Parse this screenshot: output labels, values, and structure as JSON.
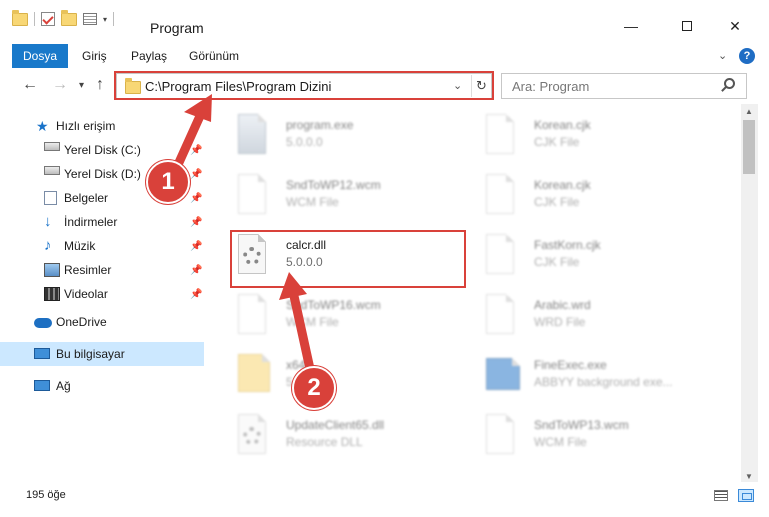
{
  "window": {
    "title": "Program",
    "minimize": "—",
    "close": "✕"
  },
  "ribbon": {
    "tabs": [
      "Dosya",
      "Giriş",
      "Paylaş",
      "Görünüm"
    ],
    "expand": "⌄",
    "help": "?"
  },
  "nav": {
    "back": "←",
    "forward": "→",
    "recent": "▾",
    "up": "↑",
    "address": "C:\\Program Files\\Program Dizini",
    "address_chevron": "⌄",
    "refresh": "↻",
    "search_placeholder": "Ara: Program"
  },
  "sidebar": {
    "quick_access": "Hızlı erişim",
    "items": [
      {
        "label": "Yerel Disk (C:)",
        "icon": "drive-icon"
      },
      {
        "label": "Yerel Disk (D:)",
        "icon": "drive-icon"
      },
      {
        "label": "Belgeler",
        "icon": "documents-icon"
      },
      {
        "label": "İndirmeler",
        "icon": "downloads-icon"
      },
      {
        "label": "Müzik",
        "icon": "music-icon"
      },
      {
        "label": "Resimler",
        "icon": "pictures-icon"
      },
      {
        "label": "Videolar",
        "icon": "videos-icon"
      }
    ],
    "pin": "📌",
    "onedrive": "OneDrive",
    "this_pc": "Bu bilgisayar",
    "network": "Ağ"
  },
  "files": {
    "left": [
      {
        "name": "program.exe",
        "sub": "5.0.0.0"
      },
      {
        "name": "SndToWP12.wcm",
        "sub": "WCM File"
      },
      {
        "name": "calcr.dll",
        "sub": "5.0.0.0"
      },
      {
        "name": "SndToWP16.wcm",
        "sub": "WCM File"
      },
      {
        "name": "x64",
        "sub": "5.0"
      },
      {
        "name": "UpdateClient65.dll",
        "sub": "Resource DLL"
      }
    ],
    "right": [
      {
        "name": "Korean.cjk",
        "sub": "CJK File"
      },
      {
        "name": "Korean.cjk",
        "sub": "CJK File"
      },
      {
        "name": "FastKorn.cjk",
        "sub": "CJK File"
      },
      {
        "name": "Arabic.wrd",
        "sub": "WRD File"
      },
      {
        "name": "FineExec.exe",
        "sub": "ABBYY background exe..."
      },
      {
        "name": "SndToWP13.wcm",
        "sub": "WCM File"
      }
    ]
  },
  "annotations": {
    "step1": "1",
    "step2": "2",
    "accent": "#d9413a"
  },
  "status": {
    "count": "195 öğe"
  },
  "scroll": {
    "up": "▲",
    "down": "▼"
  }
}
